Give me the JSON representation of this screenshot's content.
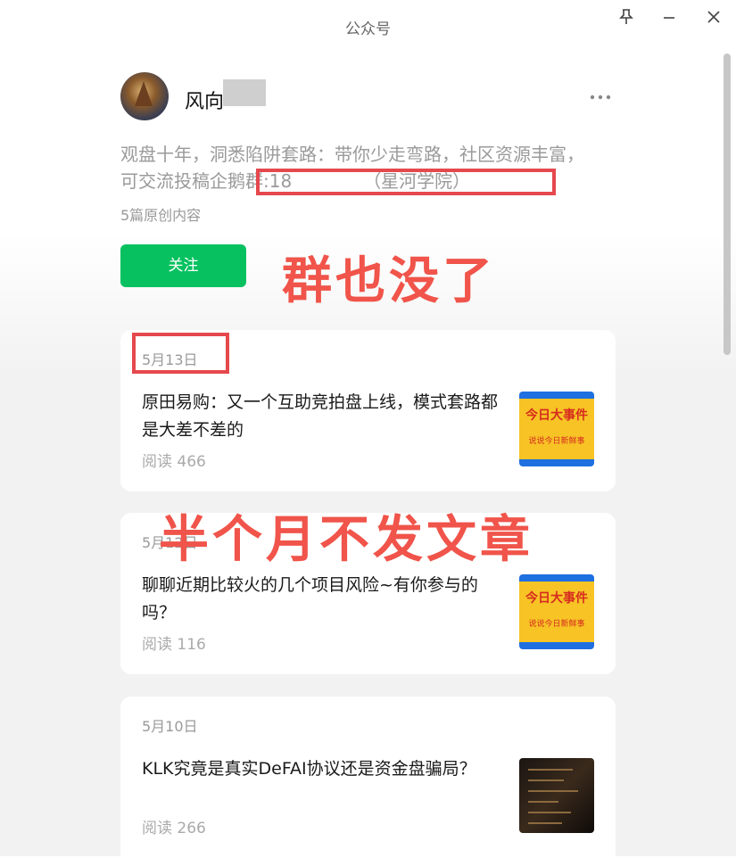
{
  "window": {
    "title": "公众号",
    "pin_icon": "pin-icon",
    "minimize_icon": "minimize-icon",
    "close_icon": "close-icon"
  },
  "account": {
    "name": "风向",
    "description_line1": "观盘十年，洞悉陷阱套路：带你少走弯路，社区资源丰富，",
    "description_line2": "可交流投稿企鹅群:18",
    "description_suffix": "（星河学院）",
    "original_count": "5篇原创内容",
    "follow_label": "关注",
    "more_icon": "more-icon"
  },
  "annotations": {
    "group_gone": "群也没了",
    "no_posts": "半个月不发文章"
  },
  "articles": [
    {
      "date": "5月13日",
      "title": "原田易购：又一个互助竞拍盘上线，模式套路都是大差不差的",
      "reads": "阅读 466",
      "thumb_title": "今日大事件",
      "thumb_sub": "说说今日新鲜事"
    },
    {
      "date": "5月12日",
      "title": "聊聊近期比较火的几个项目风险~有你参与的吗？",
      "reads": "阅读 116",
      "thumb_title": "今日大事件",
      "thumb_sub": "说说今日新鲜事"
    },
    {
      "date": "5月10日",
      "title": "KLK究竟是真实DeFAI协议还是资金盘骗局？",
      "reads": "阅读 266"
    }
  ],
  "colors": {
    "follow_green": "#07c160",
    "annotation_red": "#f0544a"
  }
}
